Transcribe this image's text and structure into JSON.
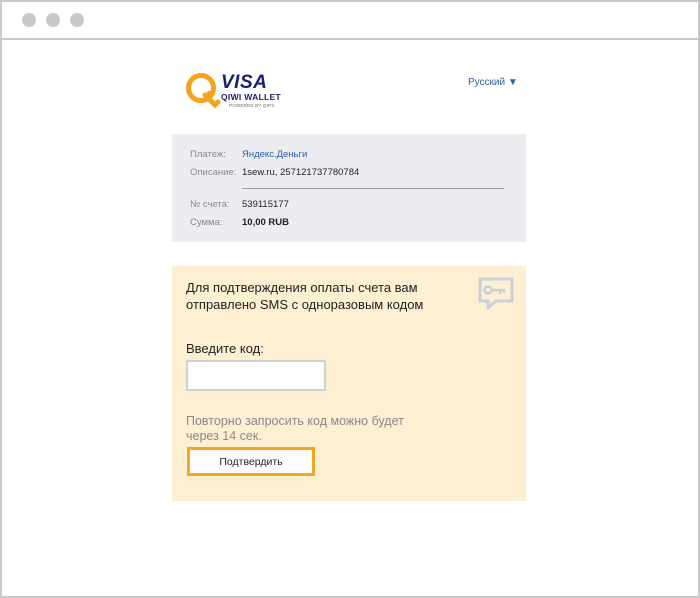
{
  "window": {
    "controls": [
      "close",
      "minimize",
      "maximize"
    ],
    "control_color": "#c9c9c9"
  },
  "logo": {
    "brand": "VISA",
    "name": "QIWI WALLET",
    "tagline": "POWERED BY QIPS",
    "icon": "qiwi-q-logo-icon"
  },
  "language": {
    "label": "Русский ▼"
  },
  "payment": {
    "payee_label": "Платеж:",
    "payee_value": "Яндекс.Деньги",
    "description_label": "Описание:",
    "description_value": "1sew.ru, 257121737780784",
    "account_label": "№ счета:",
    "account_value": "539115177",
    "amount_label": "Сумма:",
    "amount_value": "10,00 RUB"
  },
  "sms": {
    "message": "Для подтверждения оплаты счета вам отправлено SMS с одноразовым кодом",
    "code_label": "Введите код:",
    "code_value": "",
    "resend_text": "Повторно запросить код можно будет через 14 сек.",
    "confirm_label": "Подтвердить",
    "icon": "sms-key-icon"
  },
  "colors": {
    "info_bg": "#ecedf0",
    "sms_bg": "#fcefd2",
    "button_border": "#f5a623",
    "link": "#2f5fa5"
  }
}
